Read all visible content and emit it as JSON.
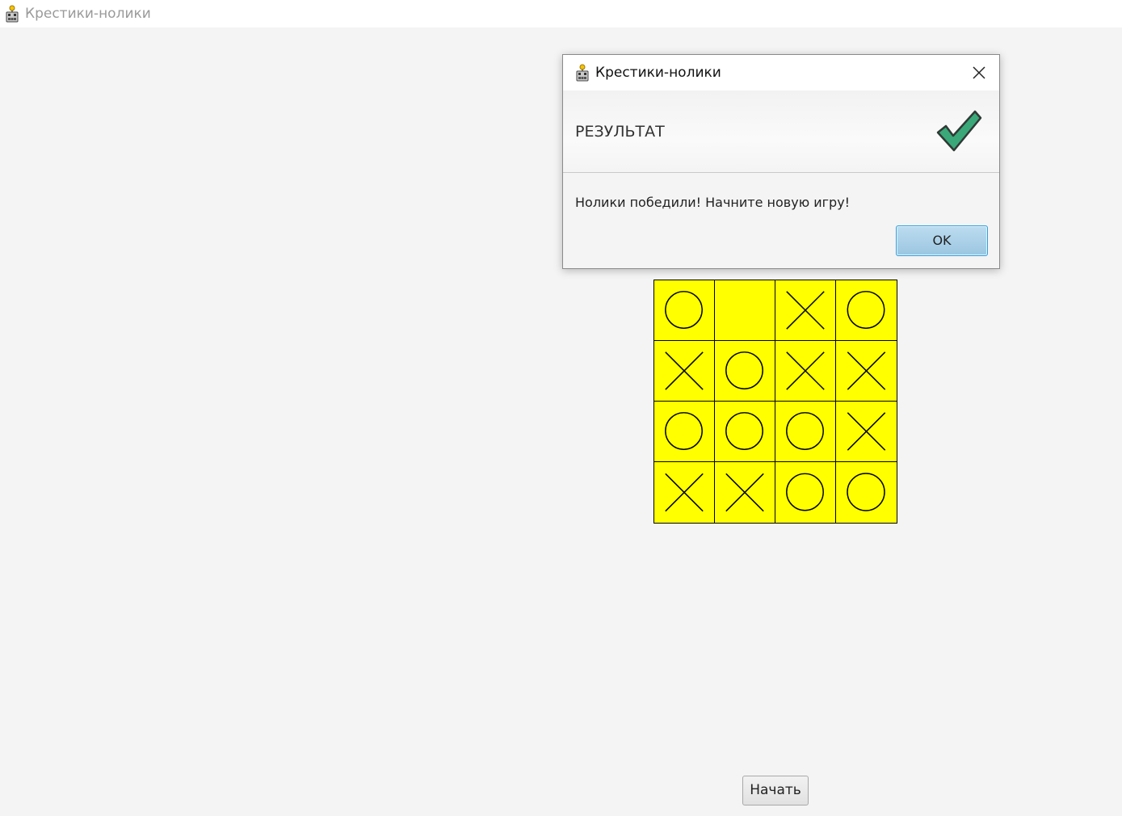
{
  "window": {
    "title": "Крестики-нолики",
    "icon": "duke-robot-icon"
  },
  "board": {
    "size": 4,
    "cells": [
      "O",
      "",
      "X",
      "O",
      "X",
      "O",
      "X",
      "X",
      "O",
      "O",
      "O",
      "X",
      "X",
      "X",
      "O",
      "O"
    ],
    "cell_color": "#ffff00",
    "line_color": "#000000"
  },
  "start_button": {
    "label": "Начать"
  },
  "dialog": {
    "title": "Крестики-нолики",
    "icon": "duke-robot-icon",
    "close_icon": "close-icon",
    "header": "РЕЗУЛЬТАТ",
    "header_icon": "checkmark-icon",
    "message": "Нолики победили! Начните новую игру!",
    "ok_label": "OK",
    "check_color": "#3aa879",
    "ok_border_color": "#2a9fe0"
  }
}
